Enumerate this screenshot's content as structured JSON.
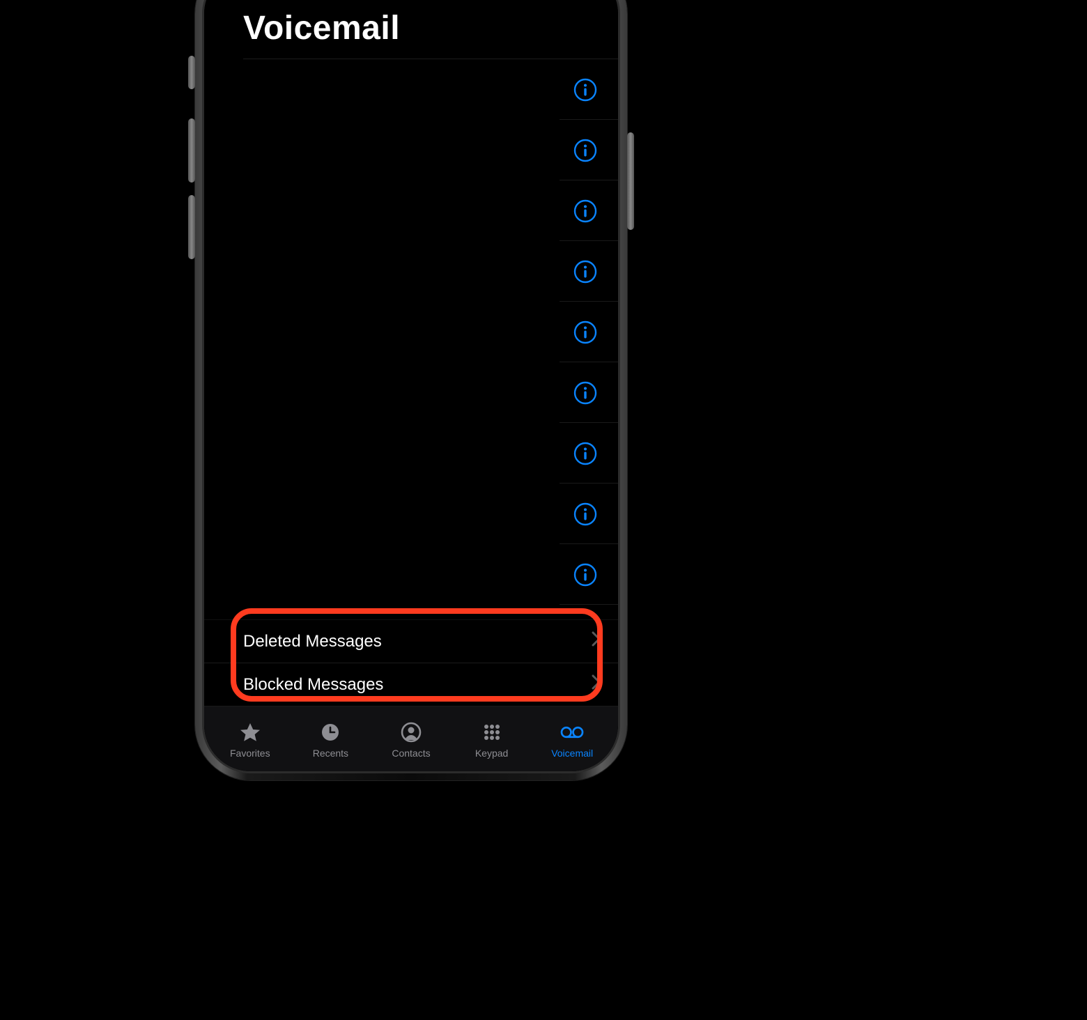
{
  "header": {
    "title": "Voicemail"
  },
  "voicemail_rows": [
    null,
    null,
    null,
    null,
    null,
    null,
    null,
    null,
    null
  ],
  "links": {
    "deleted": "Deleted Messages",
    "blocked": "Blocked Messages"
  },
  "tabs": {
    "favorites": "Favorites",
    "recents": "Recents",
    "contacts": "Contacts",
    "keypad": "Keypad",
    "voicemail": "Voicemail"
  },
  "colors": {
    "accent": "#0a84ff"
  }
}
